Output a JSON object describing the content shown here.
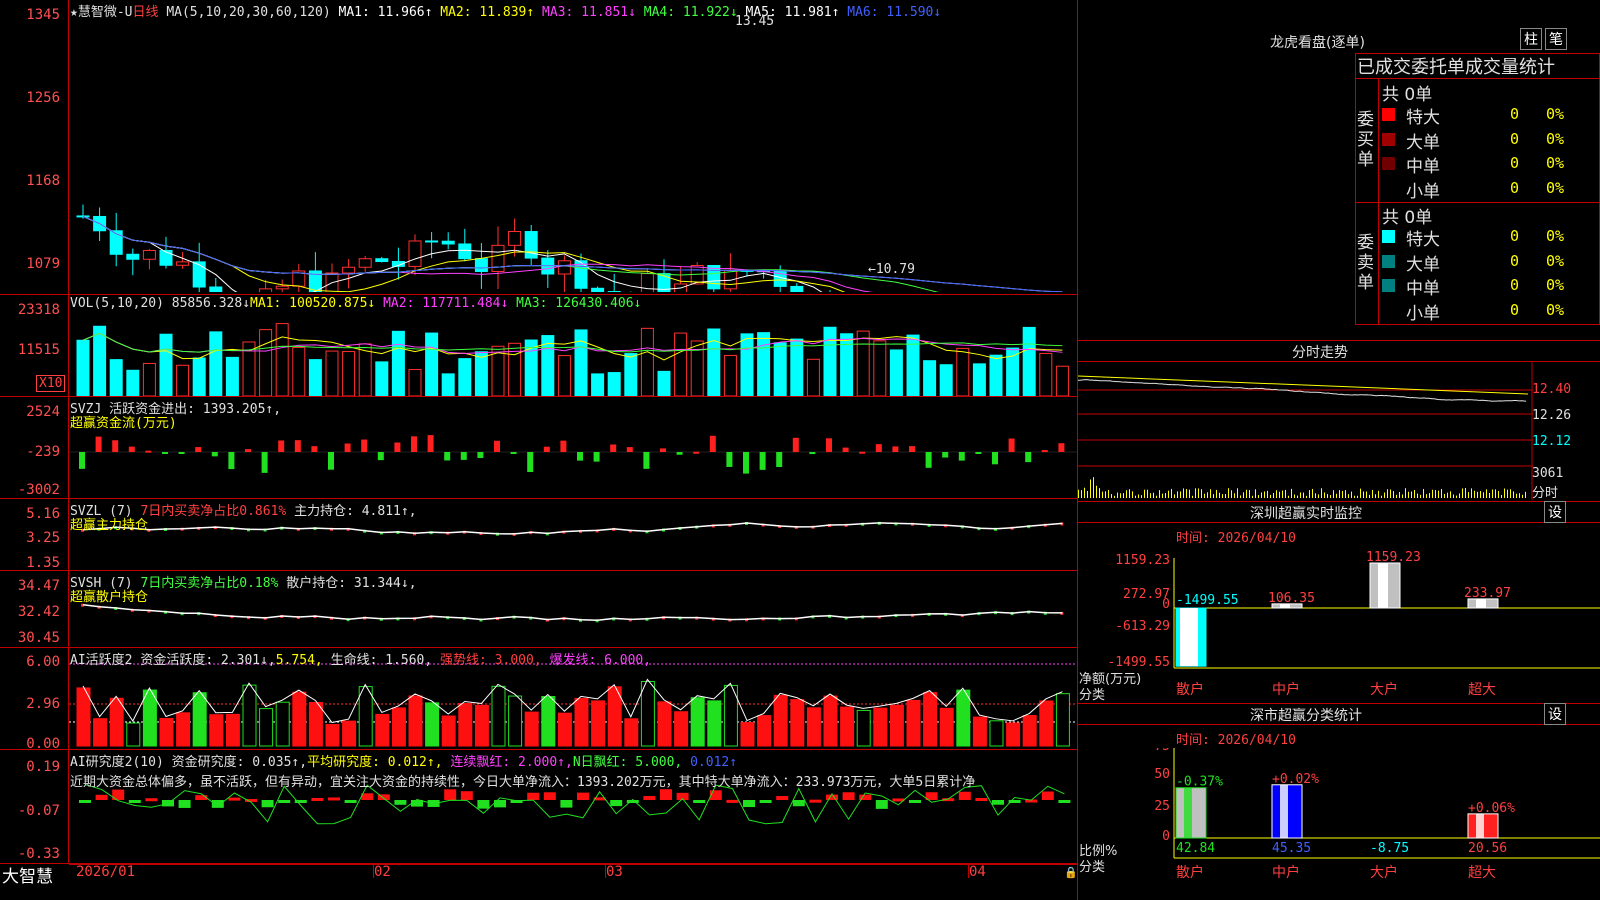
{
  "main": {
    "title_star": "★慧智微-U",
    "period": "日线",
    "ma_label": "MA(5,10,20,30,60,120)",
    "ma_values": [
      {
        "label": "MA1: 11.966↑",
        "color": "#ffffff"
      },
      {
        "label": "MA2: 11.839↑",
        "color": "#ffff00"
      },
      {
        "label": "MA3: 11.851↓",
        "color": "#ff40ff"
      },
      {
        "label": "MA4: 11.922↓",
        "color": "#40ff40"
      },
      {
        "label": "MA5: 11.981↑",
        "color": "#ffffff"
      },
      {
        "label": "MA6: 11.590↓",
        "color": "#4060ff"
      }
    ],
    "axis": [
      "1345",
      "1256",
      "1168",
      "1079"
    ],
    "high_note": "13.45",
    "low_note": "←10.79"
  },
  "vol": {
    "header": "VOL(5,10,20)",
    "value": "85856.328↓",
    "ma1": "MA1: 100520.875↓",
    "ma2": "MA2: 117711.484↓",
    "ma3": "MA3: 126430.406↓",
    "axis": [
      "23318",
      "11515"
    ],
    "unit": "X10"
  },
  "svzj": {
    "header": "SVZJ",
    "label": "活跃资金进出: 1393.205↑,",
    "sub": "超赢资金流(万元)",
    "axis": [
      "2524",
      "-239",
      "-3002"
    ]
  },
  "svzl": {
    "header": "SVZL (7)",
    "red_label": "7日内买卖净占比0.861%",
    "label": "主力持仓: 4.811↑,",
    "sub": "超赢主力持仓",
    "axis": [
      "5.16",
      "3.25",
      "1.35"
    ]
  },
  "svsh": {
    "header": "SVSH (7)",
    "grn_label": "7日内买卖净占比0.18%",
    "label": "散户持仓: 31.344↓,",
    "sub": "超赢散户持仓",
    "axis": [
      "34.47",
      "32.42",
      "30.45"
    ]
  },
  "ai1": {
    "header": "AI活跃度2",
    "label": "资金活跃度: 2.301↓,",
    "val2": "5.754,",
    "life": "生命线: 1.560,",
    "strong": "强势线: 3.000,",
    "burst": "爆发线: 6.000,",
    "axis": [
      "6.00",
      "2.96",
      "0.00"
    ]
  },
  "ai2": {
    "header": "AI研究度2(10)",
    "label": "资金研究度: 0.035↑,",
    "avg": "平均研究度: 0.012↑,",
    "cont": "连续飘红: 2.000↑,",
    "nday": "N日飘红: 5.000,",
    "last": "0.012↑",
    "comment": "近期大资金总体偏多，虽不活跃，但有异动，宜关注大资金的持续性，今日大单净流入：1393.202万元，其中特大单净流入：233.973万元，大单5日累计净",
    "axis": [
      "0.19",
      "-0.07",
      "-0.33"
    ]
  },
  "bottom": {
    "brand": "大智慧",
    "dates": [
      "2026/01",
      "02",
      "03",
      "04"
    ]
  },
  "lhb": {
    "title": "龙虎看盘(逐单)",
    "btn1": "柱",
    "btn2": "笔",
    "subtitle": "已成交委托单成交量统计",
    "buy_label": "委买单",
    "sell_label": "委卖单",
    "buy_total": "共 0单",
    "sell_total": "共 0单",
    "buy_rows": [
      {
        "name": "特大",
        "val": "0",
        "pct": "0%",
        "color": "#ff0000"
      },
      {
        "name": "大单",
        "val": "0",
        "pct": "0%",
        "color": "#a00000"
      },
      {
        "name": "中单",
        "val": "0",
        "pct": "0%",
        "color": "#700000"
      },
      {
        "name": "小单",
        "val": "0",
        "pct": "0%",
        "color": ""
      }
    ],
    "sell_rows": [
      {
        "name": "特大",
        "val": "0",
        "pct": "0%",
        "color": "#00ffff"
      },
      {
        "name": "大单",
        "val": "0",
        "pct": "0%",
        "color": "#008080"
      },
      {
        "name": "中单",
        "val": "0",
        "pct": "0%",
        "color": "#008080"
      },
      {
        "name": "小单",
        "val": "0",
        "pct": "0%",
        "color": ""
      }
    ]
  },
  "intraday": {
    "title": "分时走势",
    "axis": [
      "12.40",
      "12.26",
      "12.12"
    ],
    "vol_value": "3061",
    "vol_unit": "分时"
  },
  "sz_monitor": {
    "title": "深圳超赢实时监控",
    "btn": "设",
    "time": "时间: 2026/04/10",
    "axis": [
      "1159.23",
      "272.97",
      "0",
      "-613.29",
      "-1499.55"
    ],
    "ylabel": "净额(万元)",
    "xlabel": "分类",
    "categories": [
      "散户",
      "中户",
      "大户",
      "超大"
    ],
    "values": [
      "-1499.55",
      "106.35",
      "1159.23",
      "233.97"
    ]
  },
  "sz_class": {
    "title": "深市超赢分类统计",
    "btn": "设",
    "time": "时间: 2026/04/10",
    "axis": [
      "75",
      "50",
      "25",
      "0"
    ],
    "ylabel": "比例%",
    "xlabel": "分类",
    "categories": [
      "散户",
      "中户",
      "大户",
      "超大"
    ],
    "top_labels": [
      "-0.37%",
      "+0.02%",
      "",
      "+0.06%"
    ],
    "values": [
      "42.84",
      "45.35",
      "-8.75",
      "20.56"
    ]
  }
}
